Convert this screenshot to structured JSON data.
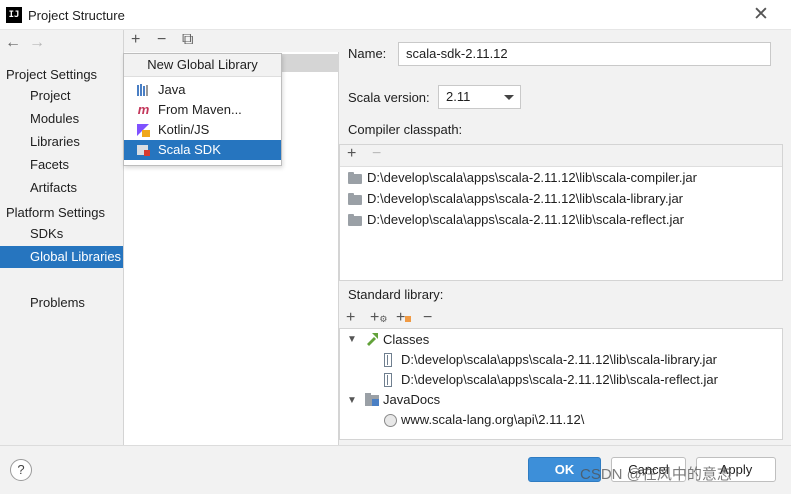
{
  "window": {
    "app_icon_text": "IJ",
    "title": "Project Structure",
    "close_glyph": "✕"
  },
  "nav": {
    "back_glyph": "←",
    "forward_glyph": "→",
    "project_settings_header": "Project Settings",
    "project_settings_items": [
      "Project",
      "Modules",
      "Libraries",
      "Facets",
      "Artifacts"
    ],
    "platform_settings_header": "Platform Settings",
    "platform_settings_items": [
      "SDKs",
      "Global Libraries"
    ],
    "selected_item": "Global Libraries",
    "problems": "Problems"
  },
  "middle_toolbar": {
    "add_glyph": "+",
    "remove_glyph": "−",
    "copy_glyph": "⧉"
  },
  "popup": {
    "title": "New Global Library",
    "items": [
      {
        "label": "Java",
        "icon": "java-library-icon"
      },
      {
        "label": "From Maven...",
        "icon": "maven-icon"
      },
      {
        "label": "Kotlin/JS",
        "icon": "kotlin-js-icon"
      },
      {
        "label": "Scala SDK",
        "icon": "scala-sdk-icon"
      }
    ],
    "selected": "Scala SDK"
  },
  "details": {
    "name_label": "Name:",
    "name_value": "scala-sdk-2.11.12",
    "scala_version_label": "Scala version:",
    "scala_version_value": "2.11",
    "compiler_classpath_label": "Compiler classpath:",
    "compiler_classpath": [
      "D:\\develop\\scala\\apps\\scala-2.11.12\\lib\\scala-compiler.jar",
      "D:\\develop\\scala\\apps\\scala-2.11.12\\lib\\scala-library.jar",
      "D:\\develop\\scala\\apps\\scala-2.11.12\\lib\\scala-reflect.jar"
    ],
    "standard_library_label": "Standard library:",
    "classes_label": "Classes",
    "classes": [
      "D:\\develop\\scala\\apps\\scala-2.11.12\\lib\\scala-library.jar",
      "D:\\develop\\scala\\apps\\scala-2.11.12\\lib\\scala-reflect.jar"
    ],
    "javadocs_label": "JavaDocs",
    "javadocs": [
      "www.scala-lang.org\\api\\2.11.12\\"
    ]
  },
  "buttons": {
    "help": "?",
    "ok": "OK",
    "cancel": "Cancel",
    "apply": "Apply"
  },
  "watermark": "CSDN @在风中的意志",
  "colors": {
    "selection": "#2675bf",
    "primary_button": "#3d8fd9",
    "scala_icon": "#d73b30",
    "maven_icon": "#c3375b",
    "java_icon": "#4a7fc4"
  }
}
